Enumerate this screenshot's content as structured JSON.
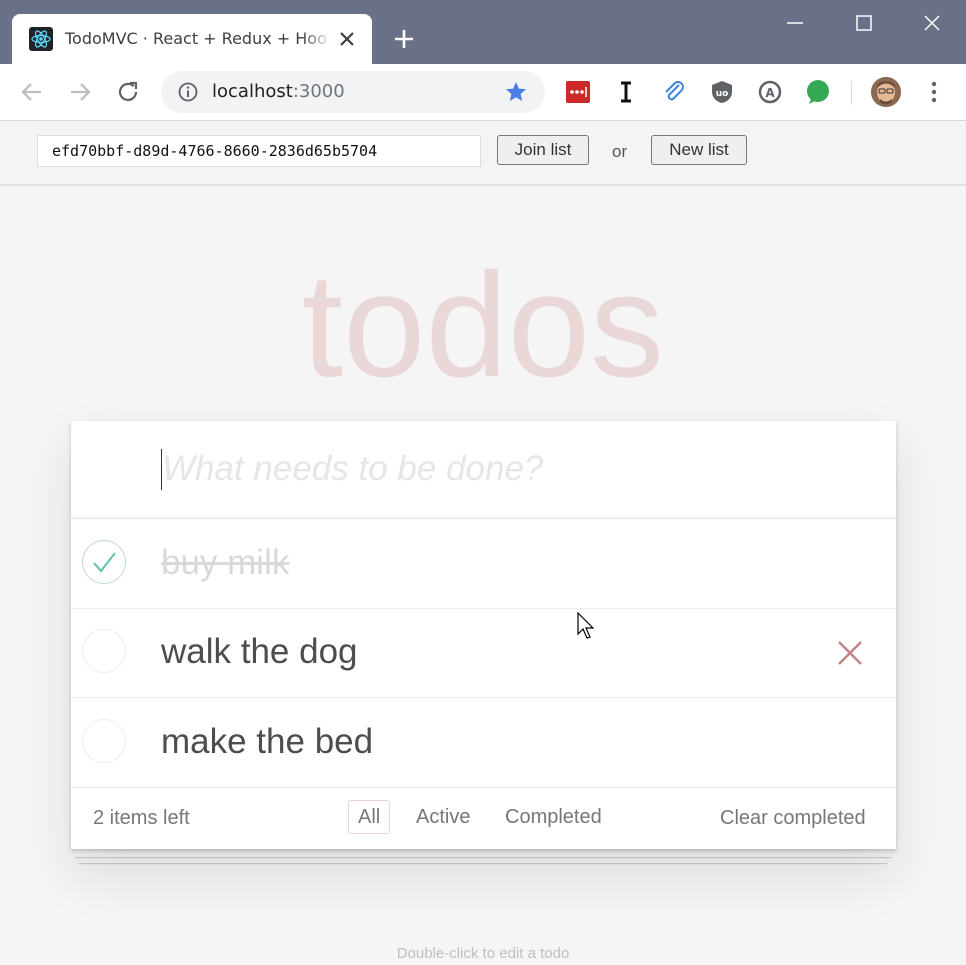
{
  "browser": {
    "tab_title": "TodoMVC · React + Redux + Hooks",
    "url_host": "localhost",
    "url_port": ":3000",
    "window_controls": [
      "minimize-icon",
      "maximize-icon",
      "close-icon"
    ],
    "extensions": [
      "lastpass-icon",
      "instapaper-icon",
      "clip-icon",
      "ublock-icon",
      "reader-icon",
      "green-dot-icon"
    ],
    "accent_color": "#6a7087"
  },
  "appbar": {
    "list_id": "efd70bbf-d89d-4766-8660-2836d65b5704",
    "join_label": "Join list",
    "or_label": "or",
    "new_label": "New list"
  },
  "todoapp": {
    "title": "todos",
    "new_todo_placeholder": "What needs to be done?",
    "items": [
      {
        "label": "buy milk",
        "completed": true
      },
      {
        "label": "walk the dog",
        "completed": false
      },
      {
        "label": "make the bed",
        "completed": false
      }
    ],
    "footer": {
      "count": "2 items left",
      "filters": [
        {
          "label": "All",
          "selected": true
        },
        {
          "label": "Active",
          "selected": false
        },
        {
          "label": "Completed",
          "selected": false
        }
      ],
      "clear_label": "Clear completed"
    },
    "info": "Double-click to edit a todo"
  }
}
